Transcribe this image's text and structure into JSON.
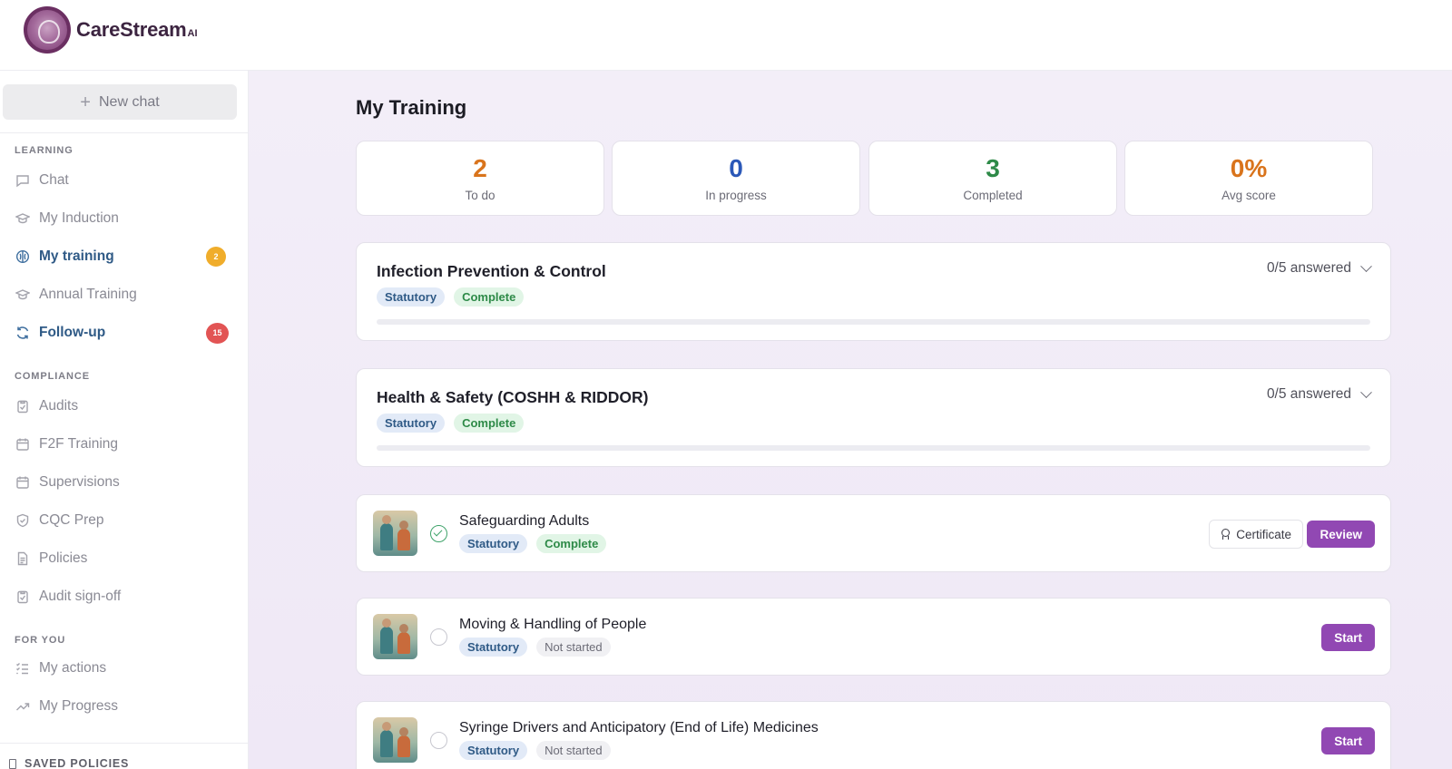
{
  "brand": {
    "name": "CareStream",
    "suffix": "AI"
  },
  "sidebar": {
    "new_chat_label": "New chat",
    "sections": {
      "learning": "LEARNING",
      "compliance": "COMPLIANCE",
      "for_you": "FOR YOU"
    },
    "items": {
      "chat": "Chat",
      "my_induction": "My Induction",
      "my_training": "My training",
      "my_training_badge": "2",
      "annual_training": "Annual Training",
      "follow_up": "Follow-up",
      "follow_up_badge": "15",
      "audits": "Audits",
      "f2f_training": "F2F Training",
      "supervisions": "Supervisions",
      "cqc_prep": "CQC Prep",
      "policies": "Policies",
      "audit_signoff": "Audit sign-off",
      "my_actions": "My actions",
      "my_progress": "My Progress"
    },
    "saved_policies_label": "SAVED POLICIES"
  },
  "main": {
    "title": "My Training",
    "stats": [
      {
        "value": "2",
        "label": "To do",
        "color": "#d9741c"
      },
      {
        "value": "0",
        "label": "In progress",
        "color": "#2b58b8"
      },
      {
        "value": "3",
        "label": "Completed",
        "color": "#2e8a48"
      },
      {
        "value": "0%",
        "label": "Avg score",
        "color": "#d9741c"
      }
    ],
    "modules": [
      {
        "title": "Infection Prevention & Control",
        "tag1": "Statutory",
        "tag2": "Complete",
        "answered": "0/5 answered",
        "progress": 0
      },
      {
        "title": "Health & Safety (COSHH & RIDDOR)",
        "tag1": "Statutory",
        "tag2": "Complete",
        "answered": "0/5 answered",
        "progress": 0
      }
    ],
    "courses": [
      {
        "title": "Safeguarding Adults",
        "tag1": "Statutory",
        "tag2": "Complete",
        "certificate_label": "Certificate",
        "action_label": "Review"
      },
      {
        "title": "Moving & Handling of People",
        "tag1": "Statutory",
        "tag2": "Not started",
        "action_label": "Start"
      },
      {
        "title": "Syringe Drivers and Anticipatory (End of Life) Medicines",
        "tag1": "Statutory",
        "tag2": "Not started",
        "action_label": "Start"
      }
    ]
  }
}
